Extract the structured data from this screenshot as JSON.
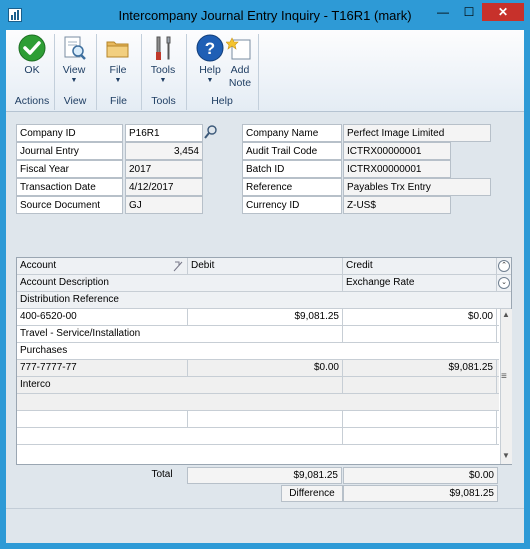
{
  "window": {
    "title": "Intercompany Journal Entry Inquiry  -  T16R1 (mark)",
    "minimize": "—",
    "maximize": "☐",
    "close": "✕"
  },
  "ribbon": {
    "ok": "OK",
    "view": "View",
    "file": "File",
    "tools": "Tools",
    "help": "Help",
    "add_note_1": "Add",
    "add_note_2": "Note",
    "groups": {
      "actions": "Actions",
      "view": "View",
      "file": "File",
      "tools": "Tools",
      "help": "Help"
    }
  },
  "header": {
    "company_id_label": "Company ID",
    "company_id": "P16R1",
    "journal_entry_label": "Journal Entry",
    "journal_entry": "3,454",
    "fiscal_year_label": "Fiscal Year",
    "fiscal_year": "2017",
    "transaction_date_label": "Transaction Date",
    "transaction_date": "4/12/2017",
    "source_document_label": "Source Document",
    "source_document": "GJ",
    "company_name_label": "Company Name",
    "company_name": "Perfect Image Limited",
    "audit_trail_label": "Audit Trail Code",
    "audit_trail": "ICTRX00000001",
    "batch_id_label": "Batch ID",
    "batch_id": "ICTRX00000001",
    "reference_label": "Reference",
    "reference": "Payables Trx Entry",
    "currency_id_label": "Currency ID",
    "currency_id": "Z-US$"
  },
  "grid": {
    "col_account": "Account",
    "col_debit": "Debit",
    "col_credit": "Credit",
    "col_account_desc": "Account Description",
    "col_exchange_rate": "Exchange Rate",
    "col_dist_ref": "Distribution Reference",
    "rows": [
      {
        "account": "400-6520-00",
        "debit": "$9,081.25",
        "credit": "$0.00",
        "description": "Travel - Service/Installation",
        "reference": "Purchases"
      },
      {
        "account": "777-7777-77",
        "debit": "$0.00",
        "credit": "$9,081.25",
        "description": "",
        "reference": "Interco"
      }
    ]
  },
  "totals": {
    "total_label": "Total",
    "total_debit": "$9,081.25",
    "total_credit": "$0.00",
    "difference_label": "Difference",
    "difference": "$9,081.25"
  },
  "colors": {
    "title_bar": "#2e9ad6",
    "close_button": "#c7312b",
    "ok_green": "#2e9e35",
    "help_blue": "#1f5fb5"
  }
}
